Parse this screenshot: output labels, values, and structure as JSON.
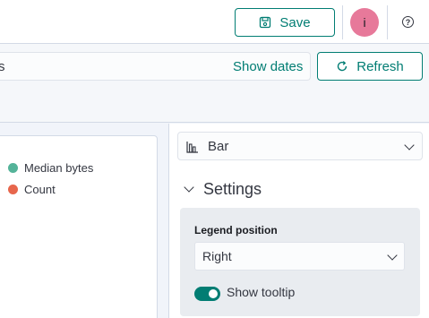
{
  "header": {
    "save_label": "Save",
    "avatar_initial": "i",
    "help_label": "?"
  },
  "query_bar": {
    "query_text": "s",
    "show_dates_label": "Show dates",
    "refresh_label": "Refresh"
  },
  "chart": {
    "legend": [
      {
        "label": "Median bytes",
        "color": "#54b399"
      },
      {
        "label": "Count",
        "color": "#e7664c"
      }
    ]
  },
  "side_panel": {
    "chart_type": "Bar",
    "settings_title": "Settings",
    "legend_position_label": "Legend position",
    "legend_position_value": "Right",
    "show_tooltip_label": "Show tooltip",
    "show_tooltip_on": true
  },
  "colors": {
    "accent": "#017d73",
    "avatar_bg": "#e7799a"
  }
}
